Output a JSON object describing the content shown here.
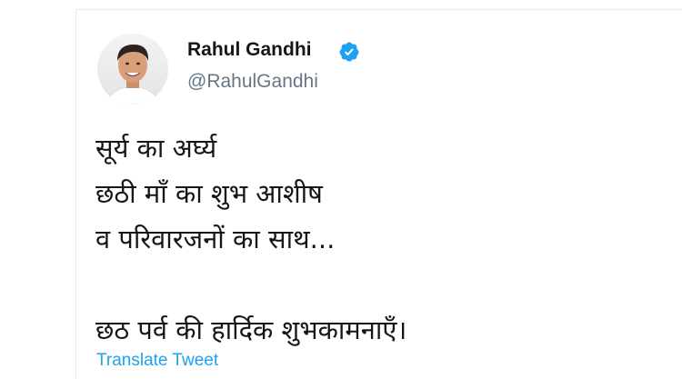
{
  "tweet": {
    "author": {
      "name": "Rahul Gandhi",
      "handle": "@RahulGandhi",
      "verified": true,
      "avatar_icon": "profile-photo",
      "verified_icon": "verified-badge-icon"
    },
    "lines": [
      "सूर्य का अर्घ्य",
      "छठी माँ का शुभ आशीष",
      "व परिवारजनों का साथ...",
      "छठ पर्व की हार्दिक शुभकामनाएँ।"
    ],
    "translate_label": "Translate Tweet"
  },
  "colors": {
    "text": "#14171a",
    "secondary": "#657786",
    "accent": "#1da1f2",
    "divider": "#e6ecf0"
  }
}
